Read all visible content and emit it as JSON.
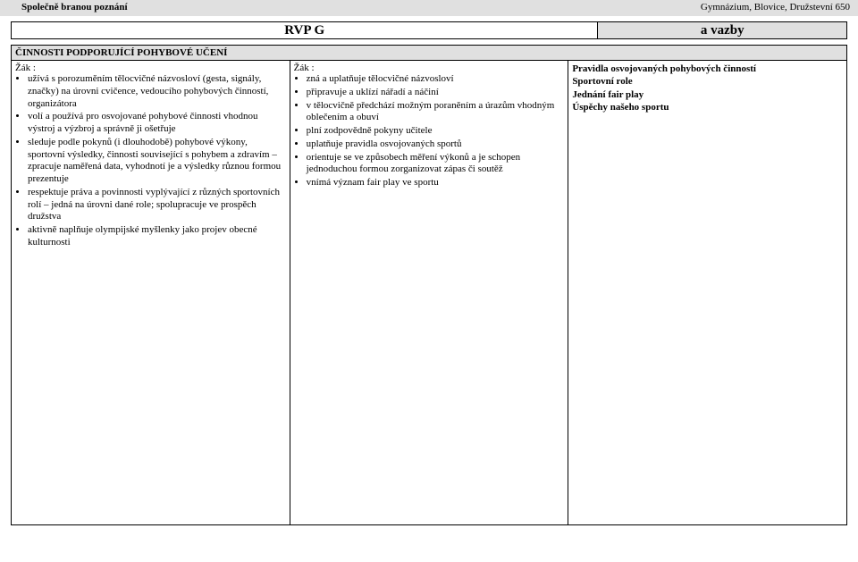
{
  "header": {
    "left": "Společně branou poznání",
    "right": "Gymnázium, Blovice, Družstevní 650"
  },
  "rvp": {
    "left": "RVP G",
    "right": "a vazby"
  },
  "section": {
    "title": "ČINNOSTI PODPORUJÍCÍ POHYBOVÉ UČENÍ"
  },
  "col1": {
    "label": "Žák :",
    "items": [
      "užívá s porozuměním tělocvičné názvosloví (gesta, signály, značky) na úrovni cvičence, vedoucího pohybových činností, organizátora",
      "volí a používá pro osvojované pohybové činnosti vhodnou výstroj a výzbroj a správně ji ošetřuje",
      "sleduje podle pokynů (i dlouhodobě) pohybové výkony, sportovní výsledky, činnosti související s pohybem a zdravím – zpracuje naměřená data, vyhodnotí je a výsledky různou formou prezentuje",
      "respektuje práva a povinnosti vyplývající z různých sportovních rolí – jedná na úrovni dané role; spolupracuje ve prospěch družstva",
      "aktivně naplňuje olympijské myšlenky jako projev obecné kulturnosti"
    ]
  },
  "col2": {
    "label": "Žák :",
    "items": [
      "zná a uplatňuje tělocvičné názvosloví",
      "připravuje a uklízí nářadí a náčiní",
      "v tělocvičně předchází možným poraněním a úrazům vhodným oblečením a obuví",
      "plní zodpovědně pokyny učitele",
      "uplatňuje pravidla osvojovaných sportů",
      "orientuje se ve způsobech měření výkonů a je schopen jednoduchou formou zorganizovat zápas či soutěž",
      "vnímá význam fair play ve sportu"
    ]
  },
  "col3": {
    "lines": [
      {
        "text": "Pravidla osvojovaných pohybových činností",
        "bold": true
      },
      {
        "text": "Sportovní role",
        "bold": true
      },
      {
        "text": "Jednání fair play",
        "bold": true
      },
      {
        "text": "Úspěchy našeho sportu",
        "bold": true
      }
    ]
  }
}
